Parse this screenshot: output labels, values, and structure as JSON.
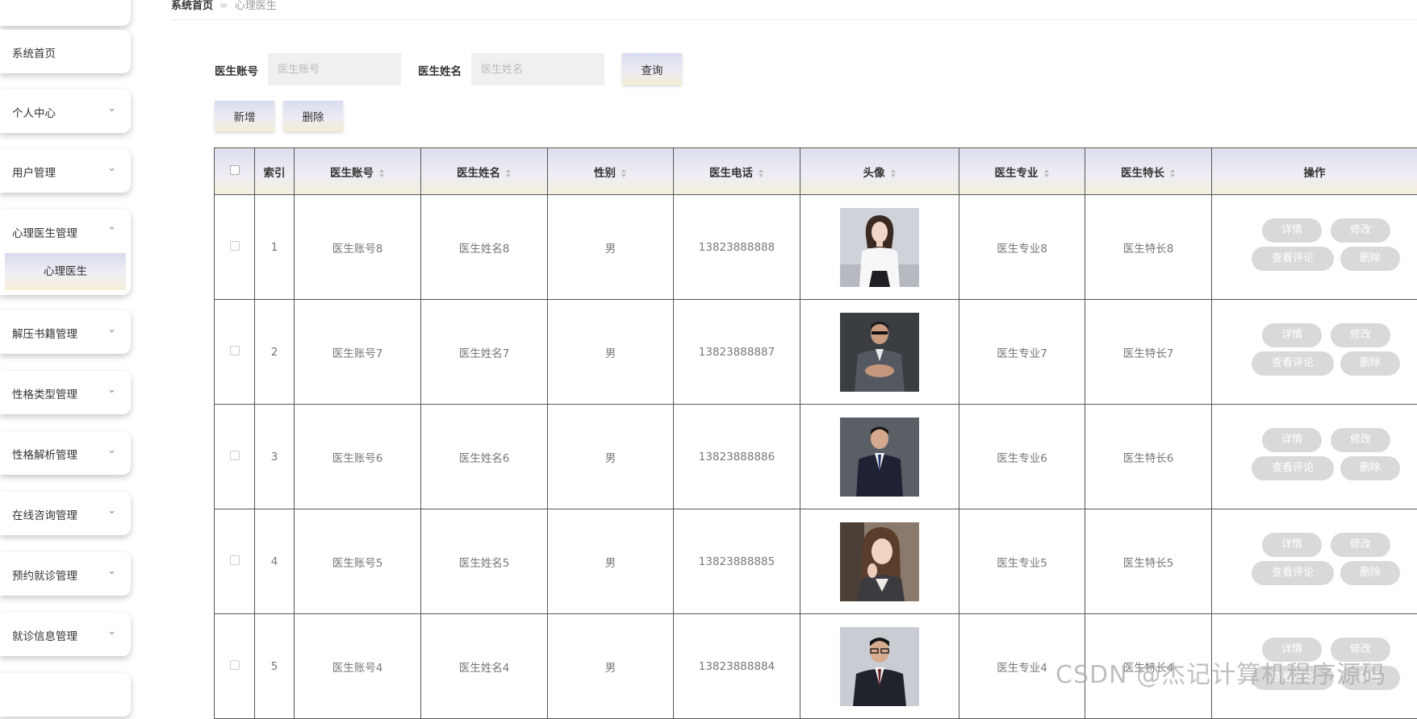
{
  "breadcrumb": {
    "home": "系统首页",
    "separator": "=",
    "current": "心理医生"
  },
  "sidebar": {
    "items": [
      {
        "label": "系统首页",
        "has_arrow": false
      },
      {
        "label": "个人中心",
        "has_arrow": true,
        "arrow": "⌄"
      },
      {
        "label": "用户管理",
        "has_arrow": true,
        "arrow": "⌄"
      },
      {
        "label": "心理医生管理",
        "has_arrow": true,
        "arrow": "⌃",
        "expanded": true,
        "subitems": [
          "心理医生"
        ]
      },
      {
        "label": "解压书籍管理",
        "has_arrow": true,
        "arrow": "⌄"
      },
      {
        "label": "性格类型管理",
        "has_arrow": true,
        "arrow": "⌄"
      },
      {
        "label": "性格解析管理",
        "has_arrow": true,
        "arrow": "⌄"
      },
      {
        "label": "在线咨询管理",
        "has_arrow": true,
        "arrow": "⌄"
      },
      {
        "label": "预约就诊管理",
        "has_arrow": true,
        "arrow": "⌄"
      },
      {
        "label": "就诊信息管理",
        "has_arrow": true,
        "arrow": "⌄"
      }
    ]
  },
  "search": {
    "account_label": "医生账号",
    "account_placeholder": "医生账号",
    "account_value": "",
    "name_label": "医生姓名",
    "name_placeholder": "医生姓名",
    "name_value": "",
    "query_button": "查询"
  },
  "actions": {
    "add_button": "新增",
    "delete_button": "删除"
  },
  "table": {
    "columns": [
      "索引",
      "医生账号",
      "医生姓名",
      "性别",
      "医生电话",
      "头像",
      "医生专业",
      "医生特长",
      "操作"
    ],
    "sortable": [
      false,
      true,
      true,
      true,
      true,
      true,
      true,
      true,
      false
    ],
    "row_buttons": {
      "detail": "详情",
      "edit": "修改",
      "comments": "查看评论",
      "delete": "删除"
    },
    "rows": [
      {
        "index": "1",
        "account": "医生账号8",
        "name": "医生姓名8",
        "gender": "男",
        "phone": "13823888888",
        "avatar": "woman-white-shirt",
        "major": "医生专业8",
        "specialty": "医生特长8"
      },
      {
        "index": "2",
        "account": "医生账号7",
        "name": "医生姓名7",
        "gender": "男",
        "phone": "13823888887",
        "avatar": "man-seated-suit",
        "major": "医生专业7",
        "specialty": "医生特长7"
      },
      {
        "index": "3",
        "account": "医生账号6",
        "name": "医生姓名6",
        "gender": "男",
        "phone": "13823888886",
        "avatar": "man-navy-suit",
        "major": "医生专业6",
        "specialty": "医生特长6"
      },
      {
        "index": "4",
        "account": "医生账号5",
        "name": "医生姓名5",
        "gender": "男",
        "phone": "13823888885",
        "avatar": "woman-long-hair",
        "major": "医生专业5",
        "specialty": "医生特长5"
      },
      {
        "index": "5",
        "account": "医生账号4",
        "name": "医生姓名4",
        "gender": "男",
        "phone": "13823888884",
        "avatar": "man-glasses-suit",
        "major": "医生专业4",
        "specialty": "医生特长4"
      }
    ]
  },
  "watermark": "CSDN @杰记计算机程序源码",
  "colors": {
    "header_gradient_top": "#dcdff0",
    "header_gradient_bottom": "#f5efdc",
    "op_button": "#d9d9d9",
    "input_bg": "#f0f0f0"
  }
}
